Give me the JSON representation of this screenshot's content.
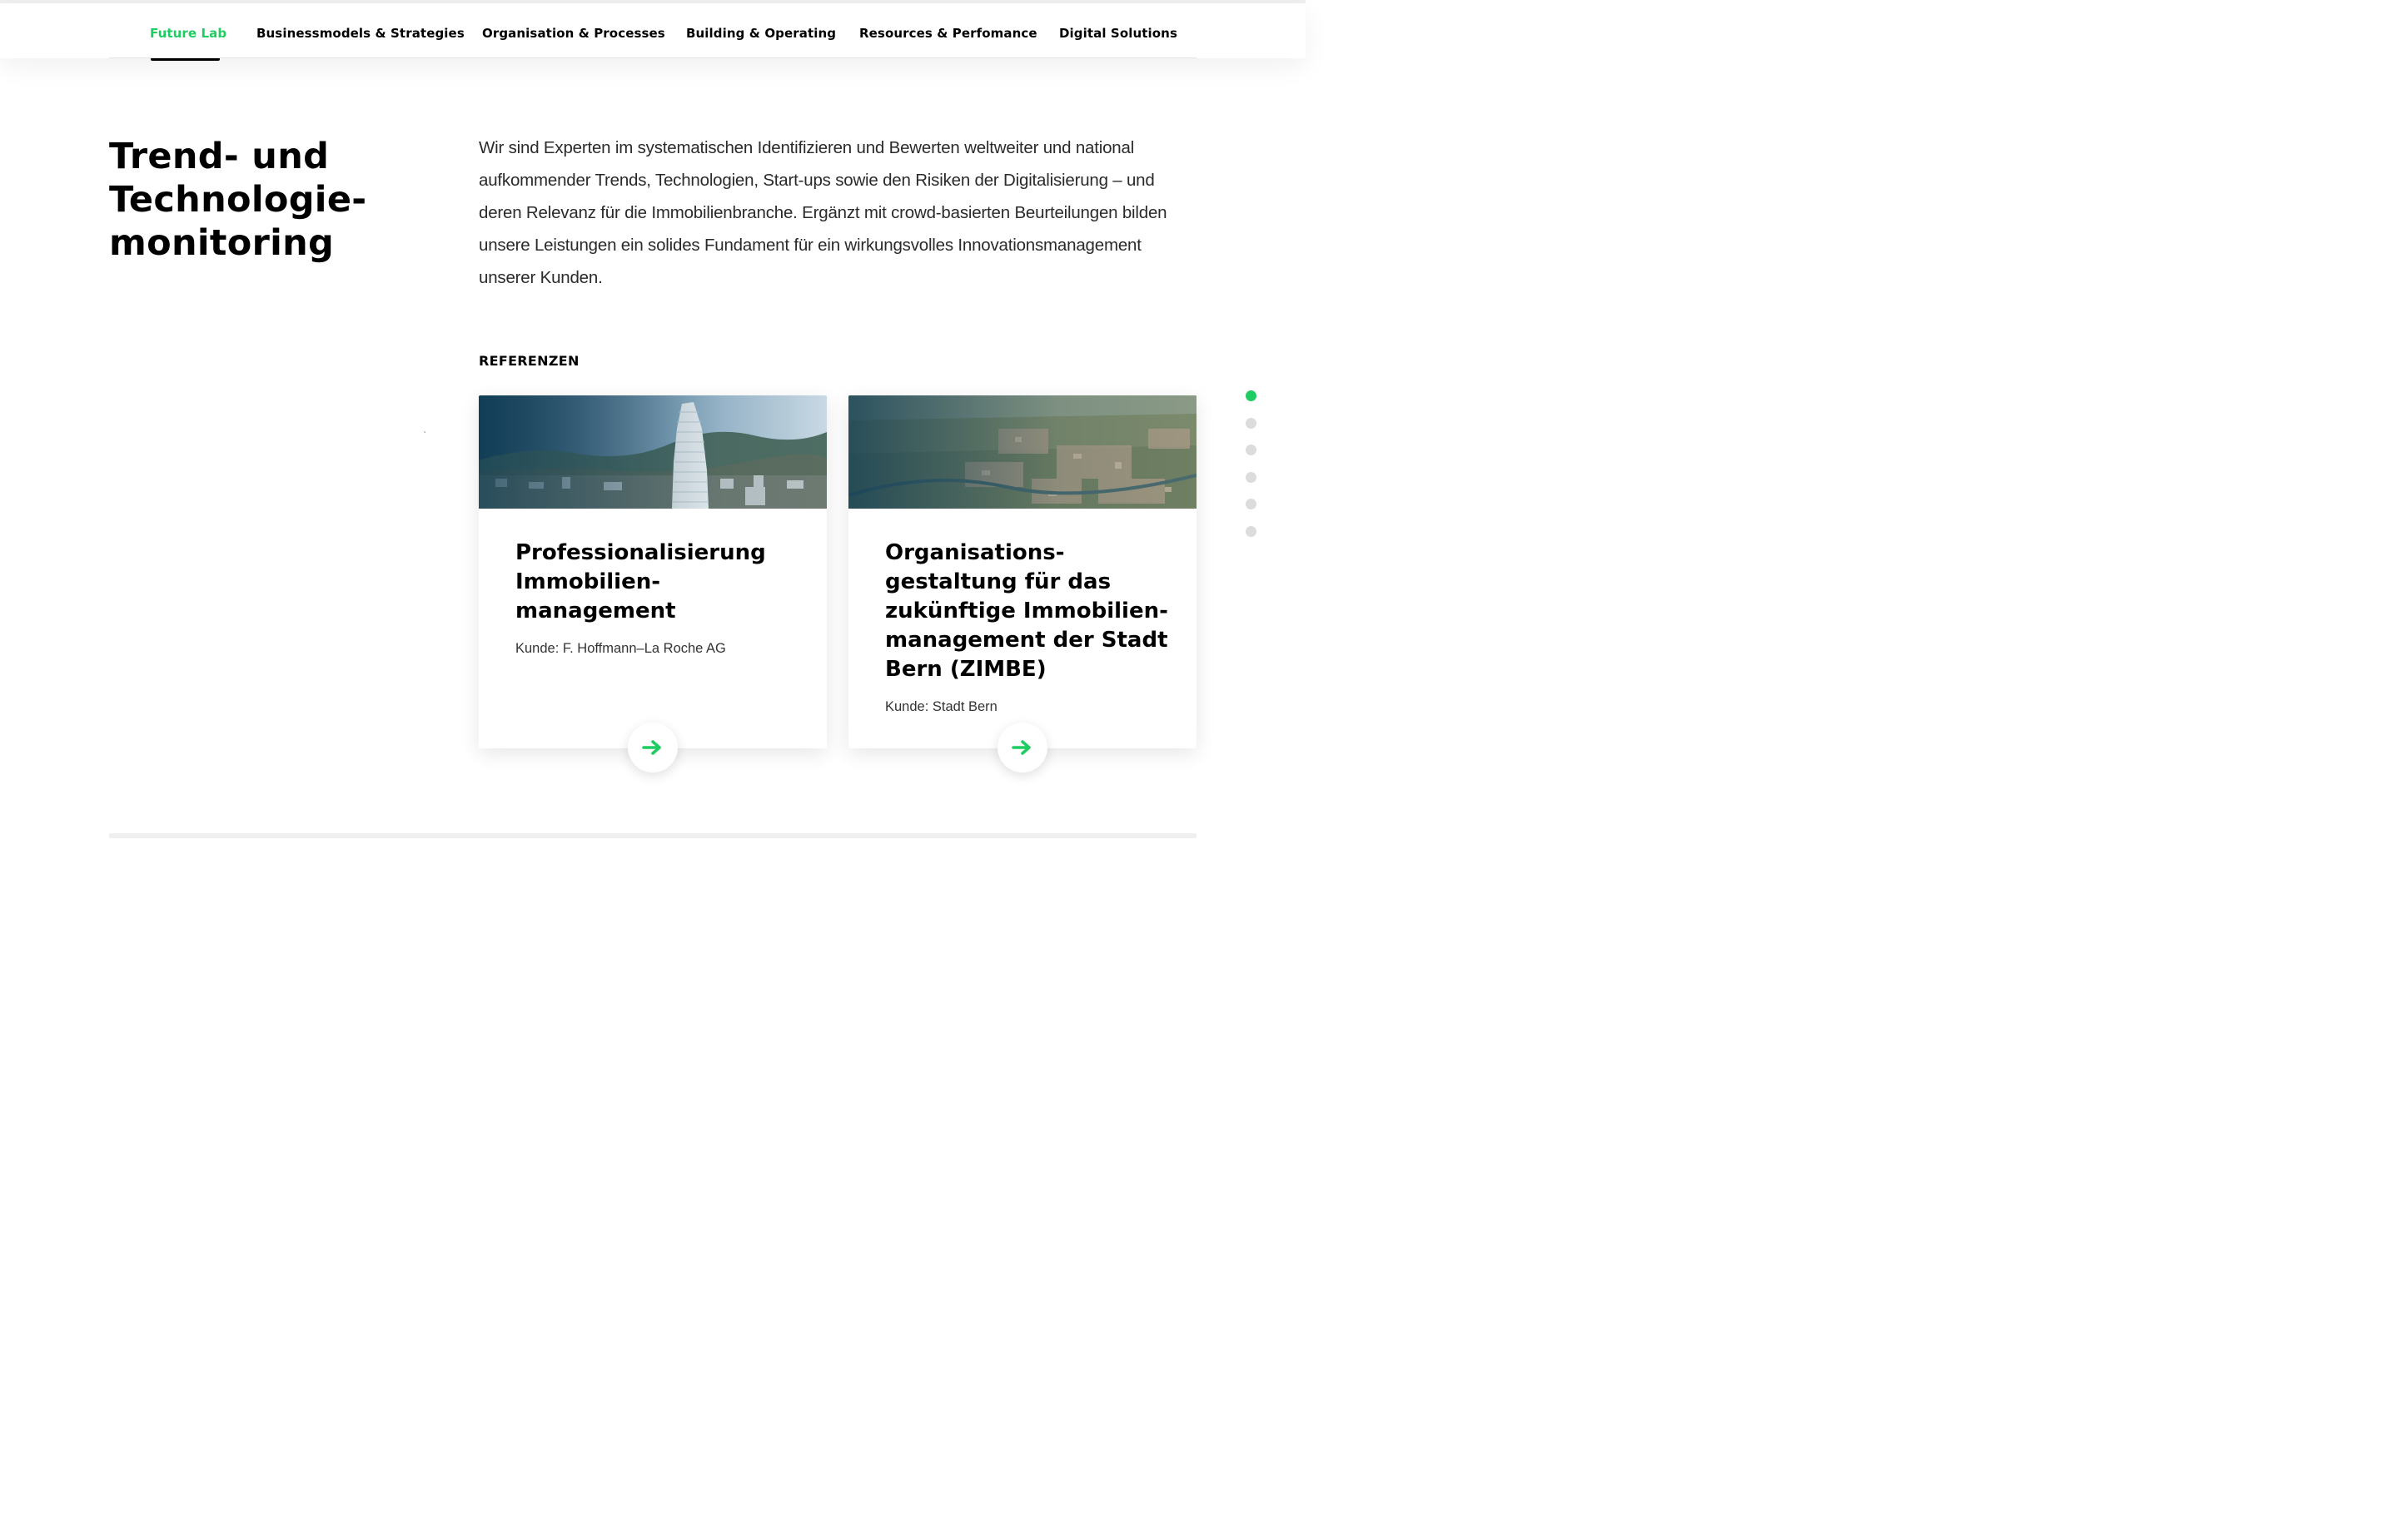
{
  "nav": {
    "items": [
      {
        "label": "Future Lab",
        "active": true
      },
      {
        "label": "Businessmodels & Strategies",
        "active": false
      },
      {
        "label": "Organisation & Processes",
        "active": false
      },
      {
        "label": "Building & Operating",
        "active": false
      },
      {
        "label": "Resources & Perfomance",
        "active": false
      },
      {
        "label": "Digital Solutions",
        "active": false
      }
    ]
  },
  "section": {
    "headline_lines": [
      "Trend- und",
      "Technologie-",
      "monitoring"
    ],
    "intro": "Wir sind Experten im systematischen Identifizieren und Bewerten weltweiter und national aufkommender Trends, Technologien, Start-ups sowie den Risiken der Digitalisierung – und deren Relevanz für die Immobilienbranche. Ergänzt mit crowd-basierten Beurteilungen bilden unsere Leistungen ein solides Fundament für ein wirkungsvolles Innovationsmanagement unserer Kunden.",
    "references_label": "REFERENZEN",
    "tick": "`"
  },
  "cards": [
    {
      "title_lines": [
        "Professionalisierung",
        "Immobilien-",
        "management"
      ],
      "client": "Kunde: F. Hoffmann–La Roche AG",
      "image": "city-tower-photo",
      "arrow_icon": "arrow-right-icon"
    },
    {
      "title_lines": [
        "Organisations-",
        "gestaltung für das",
        "zukünftige Immobilien-",
        "management der Stadt",
        "Bern (ZIMBE)"
      ],
      "client": "Kunde: Stadt Bern",
      "image": "aerial-city-photo",
      "arrow_icon": "arrow-right-icon"
    }
  ],
  "pager": {
    "count": 6,
    "active_index": 0
  },
  "colors": {
    "accent": "#1fcc62",
    "text": "#000000",
    "muted": "#dcdcdc"
  }
}
